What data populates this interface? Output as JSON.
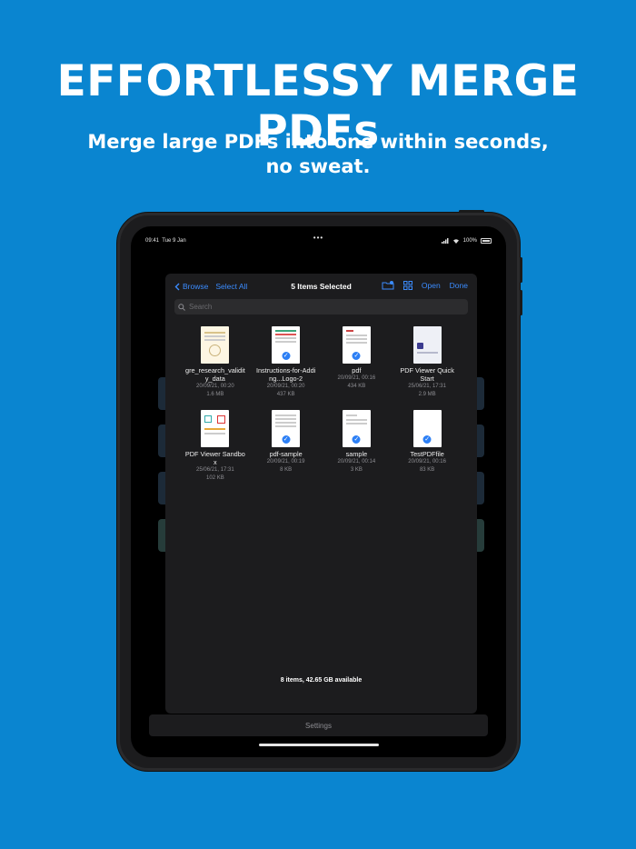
{
  "headline": "EFFORTLESSY MERGE PDFs",
  "subline": [
    "Merge large PDFs into one within seconds,",
    "no sweat."
  ],
  "status": {
    "time": "09:41",
    "date": "Tue 9 Jan",
    "center": "•••",
    "battery": "100%"
  },
  "nav": {
    "browse": "Browse",
    "select_all": "Select All",
    "title": "5 Items Selected",
    "open": "Open",
    "done": "Done"
  },
  "search": {
    "placeholder": "Search"
  },
  "files": [
    {
      "name": "gre_research_validity_data",
      "date": "20/09/21, 00:20",
      "size": "1.6 MB",
      "selected": false
    },
    {
      "name": "Instructions-for-Adding...Logo-2",
      "date": "20/09/21, 00:20",
      "size": "437 KB",
      "selected": true
    },
    {
      "name": "pdf",
      "date": "20/09/21, 00:16",
      "size": "434 KB",
      "selected": true
    },
    {
      "name": "PDF Viewer Quick Start",
      "date": "25/06/21, 17:31",
      "size": "2.9 MB",
      "selected": false
    },
    {
      "name": "PDF Viewer Sandbox",
      "date": "25/06/21, 17:31",
      "size": "102 KB",
      "selected": false
    },
    {
      "name": "pdf-sample",
      "date": "20/09/21, 00:19",
      "size": "8 KB",
      "selected": true
    },
    {
      "name": "sample",
      "date": "20/09/21, 00:14",
      "size": "3 KB",
      "selected": true
    },
    {
      "name": "TestPDFfile",
      "date": "20/09/21, 00:16",
      "size": "83 KB",
      "selected": true
    }
  ],
  "footer": "8 items, 42.65 GB available",
  "settings": "Settings",
  "colors": {
    "background": "#0a85d0",
    "accent": "#3b8cff",
    "sheet": "#1c1c1e"
  }
}
